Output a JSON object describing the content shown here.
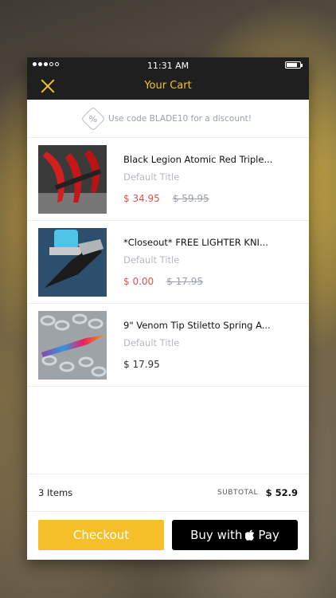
{
  "status_bar": {
    "time": "11:31 AM"
  },
  "header": {
    "title": "Your Cart"
  },
  "promo": {
    "icon": "percent-tag-icon",
    "text": "Use code BLADE10 for a discount!"
  },
  "cart_items": [
    {
      "title": "Black Legion Atomic Red Triple...",
      "variant": "Default Title",
      "price": "$ 34.95",
      "compare_price": "$ 59.95"
    },
    {
      "title": "*Closeout* FREE LIGHTER KNI...",
      "variant": "Default Title",
      "price": "$ 0.00",
      "compare_price": "$ 17.95"
    },
    {
      "title": "9\" Venom Tip Stiletto Spring A...",
      "variant": "Default Title",
      "price": "$ 17.95",
      "compare_price": ""
    }
  ],
  "summary": {
    "count": "3 Items",
    "subtotal_label": "SUBTOTAL",
    "subtotal_value": "$ 52.9"
  },
  "actions": {
    "checkout_label": "Checkout",
    "pay_label": "Buy with",
    "pay_suffix": "Pay"
  },
  "colors": {
    "accent": "#f1c232",
    "checkout": "#f5bf2a",
    "sale_price": "#d9534f",
    "topbar": "#1f1f1f"
  }
}
